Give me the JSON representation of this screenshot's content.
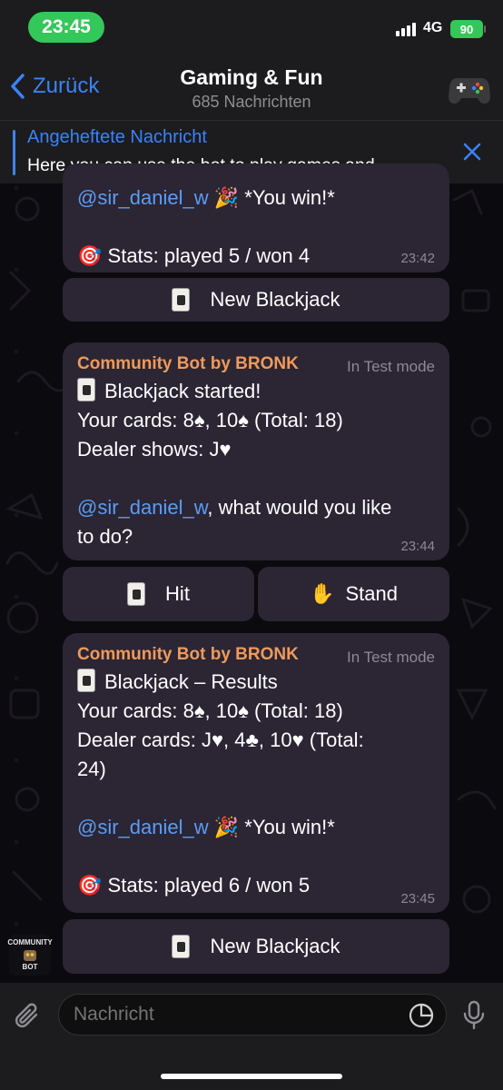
{
  "status_bar": {
    "time": "23:45",
    "network": "4G",
    "battery": "90"
  },
  "header": {
    "back_label": "Zurück",
    "title": "Gaming & Fun",
    "subtitle": "685 Nachrichten"
  },
  "pinned": {
    "title": "Angeheftete Nachricht",
    "text": "Here you can use the bot to play games and..."
  },
  "messages": [
    {
      "lines": [
        "@sir_daniel_w",
        "🎉 *You win!*",
        "🎯 Stats: played 5 / won 4"
      ],
      "mention": "@sir_daniel_w",
      "win_text": "*You win!*",
      "stats": "Stats: played 5 / won 4",
      "time": "23:42"
    },
    {
      "sender": "Community Bot by BRONK",
      "mode": "In Test mode",
      "title": "Blackjack started!",
      "cards": "Your cards: 8♠, 10♠ (Total: 18)",
      "dealer": "Dealer shows: J♥",
      "mention": "@sir_daniel_w",
      "question_rest": ", what would you like",
      "question_end": "to do?",
      "time": "23:44"
    },
    {
      "sender": "Community Bot by BRONK",
      "mode": "In Test mode",
      "title": "Blackjack – Results",
      "cards": "Your cards: 8♠, 10♠ (Total: 18)",
      "dealer_line1": "Dealer cards: J♥, 4♣, 10♥ (Total:",
      "dealer_line2": "24)",
      "mention": "@sir_daniel_w",
      "win_text": "*You win!*",
      "stats": "Stats: played 6 / won 5",
      "time": "23:45"
    }
  ],
  "buttons": {
    "new_blackjack_1": "New Blackjack",
    "hit": "Hit",
    "stand": "Stand",
    "new_blackjack_2": "New Blackjack"
  },
  "bot_avatar_text": [
    "COMMUNITY",
    "BOT"
  ],
  "composer": {
    "placeholder": "Nachricht"
  },
  "colors": {
    "accent": "#3b82f6",
    "sender": "#ef9a5b",
    "bubble": "#2b2534",
    "status_green": "#34c759"
  },
  "icons": [
    "back-chevron-icon",
    "gamepad-icon",
    "close-icon",
    "playing-card-icon",
    "party-popper-icon",
    "target-icon",
    "hand-icon",
    "paperclip-icon",
    "sticker-icon",
    "microphone-icon"
  ]
}
